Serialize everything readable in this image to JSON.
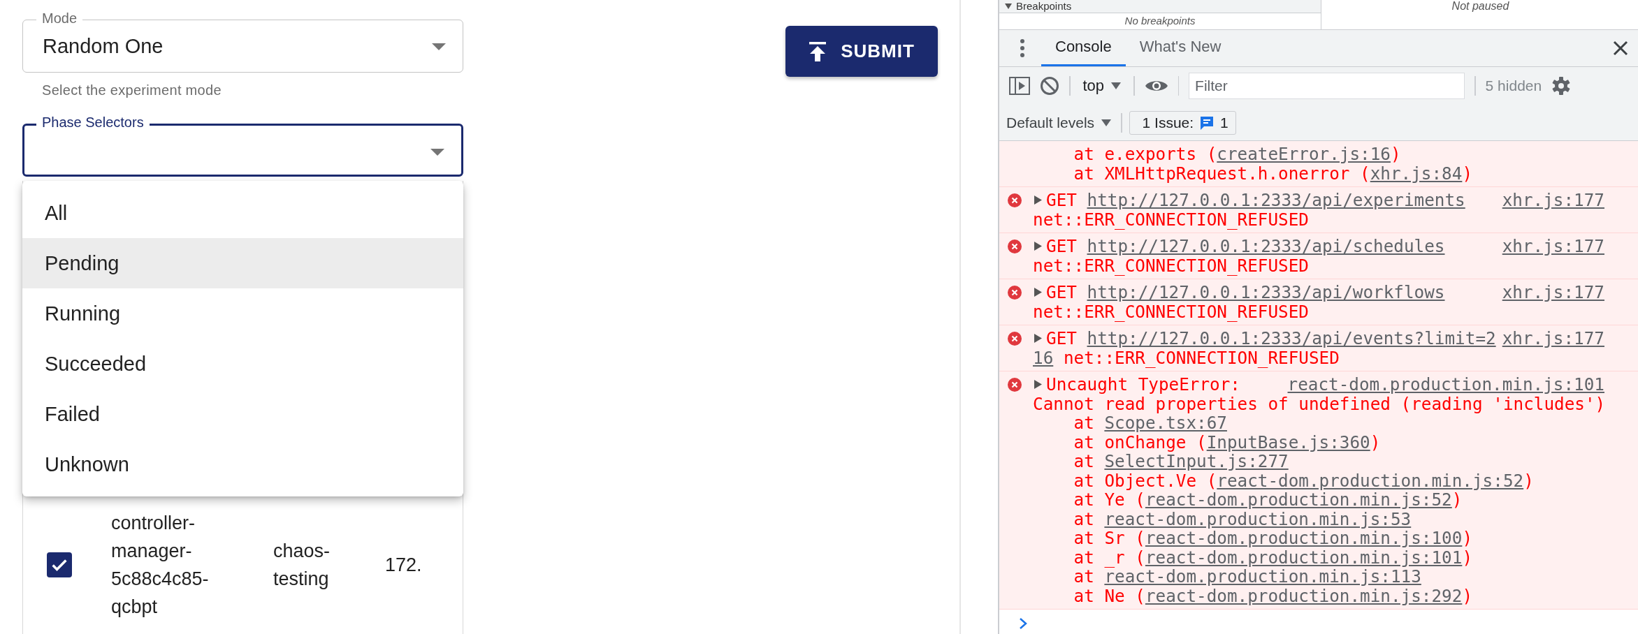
{
  "form": {
    "mode": {
      "label": "Mode",
      "value": "Random One",
      "helper": "Select the experiment mode"
    },
    "phase_selectors": {
      "label": "Phase Selectors",
      "focused": true
    },
    "submit_button": "SUBMIT"
  },
  "menu": {
    "items": [
      {
        "label": "All",
        "selected": false
      },
      {
        "label": "Pending",
        "selected": true
      },
      {
        "label": "Running",
        "selected": false
      },
      {
        "label": "Succeeded",
        "selected": false
      },
      {
        "label": "Failed",
        "selected": false
      },
      {
        "label": "Unknown",
        "selected": false
      }
    ]
  },
  "table": {
    "rows": [
      {
        "checked": true,
        "cells": [
          "controller-manager-5c88c4c85-qcbpt",
          "chaos-testing",
          "172."
        ]
      }
    ]
  },
  "devtools": {
    "sources": {
      "breakpoints_header": "Breakpoints",
      "breakpoints_empty": "No breakpoints",
      "status": "Not paused"
    },
    "tabs": [
      {
        "label": "Console",
        "selected": true
      },
      {
        "label": "What's New",
        "selected": false
      }
    ],
    "toolbar": {
      "context": "top",
      "filter_placeholder": "Filter",
      "hidden_count": "5 hidden",
      "levels": "Default levels",
      "issues_label": "1 Issue:",
      "issues_count": "1"
    },
    "messages": [
      {
        "kind": "trace",
        "lines": [
          {
            "indent": true,
            "parts": [
              {
                "text": "at e.exports ("
              },
              {
                "text": "createError.js:16",
                "link": true
              },
              {
                "text": ")"
              }
            ]
          },
          {
            "indent": true,
            "parts": [
              {
                "text": "at XMLHttpRequest.h.onerror ("
              },
              {
                "text": "xhr.js:84",
                "link": true
              },
              {
                "text": ")"
              }
            ]
          }
        ]
      },
      {
        "kind": "error",
        "source": "xhr.js:177",
        "lines": [
          {
            "indent": false,
            "parts": [
              {
                "text": "GET "
              },
              {
                "text": "http://127.0.0.1:2333/api/experiments",
                "link": true
              }
            ]
          },
          {
            "indent": false,
            "parts": [
              {
                "text": "net::ERR_CONNECTION_REFUSED"
              }
            ]
          }
        ]
      },
      {
        "kind": "error",
        "source": "xhr.js:177",
        "lines": [
          {
            "indent": false,
            "parts": [
              {
                "text": "GET "
              },
              {
                "text": "http://127.0.0.1:2333/api/schedules",
                "link": true
              }
            ]
          },
          {
            "indent": false,
            "parts": [
              {
                "text": "net::ERR_CONNECTION_REFUSED"
              }
            ]
          }
        ]
      },
      {
        "kind": "error",
        "source": "xhr.js:177",
        "lines": [
          {
            "indent": false,
            "parts": [
              {
                "text": "GET "
              },
              {
                "text": "http://127.0.0.1:2333/api/workflows",
                "link": true
              }
            ]
          },
          {
            "indent": false,
            "parts": [
              {
                "text": "net::ERR_CONNECTION_REFUSED"
              }
            ]
          }
        ]
      },
      {
        "kind": "error",
        "source": "xhr.js:177",
        "lines": [
          {
            "indent": false,
            "parts": [
              {
                "text": "GET "
              },
              {
                "text": "http://127.0.0.1:2333/api/events?limit=2",
                "link": true
              }
            ]
          },
          {
            "indent": false,
            "parts": [
              {
                "text": "16",
                "link": true
              },
              {
                "text": " net::ERR_CONNECTION_REFUSED"
              }
            ]
          }
        ]
      },
      {
        "kind": "error",
        "source": "react-dom.production.min.js:101",
        "lines": [
          {
            "indent": false,
            "parts": [
              {
                "text": "Uncaught TypeError:"
              }
            ]
          },
          {
            "indent": false,
            "parts": [
              {
                "text": "Cannot read properties of undefined (reading 'includes')"
              }
            ]
          },
          {
            "indent": true,
            "parts": [
              {
                "text": "at "
              },
              {
                "text": "Scope.tsx:67",
                "link": true
              }
            ]
          },
          {
            "indent": true,
            "parts": [
              {
                "text": "at onChange ("
              },
              {
                "text": "InputBase.js:360",
                "link": true
              },
              {
                "text": ")"
              }
            ]
          },
          {
            "indent": true,
            "parts": [
              {
                "text": "at "
              },
              {
                "text": "SelectInput.js:277",
                "link": true
              }
            ]
          },
          {
            "indent": true,
            "parts": [
              {
                "text": "at Object.Ve ("
              },
              {
                "text": "react-dom.production.min.js:52",
                "link": true
              },
              {
                "text": ")"
              }
            ]
          },
          {
            "indent": true,
            "parts": [
              {
                "text": "at Ye ("
              },
              {
                "text": "react-dom.production.min.js:52",
                "link": true
              },
              {
                "text": ")"
              }
            ]
          },
          {
            "indent": true,
            "parts": [
              {
                "text": "at "
              },
              {
                "text": "react-dom.production.min.js:53",
                "link": true
              }
            ]
          },
          {
            "indent": true,
            "parts": [
              {
                "text": "at Sr ("
              },
              {
                "text": "react-dom.production.min.js:100",
                "link": true
              },
              {
                "text": ")"
              }
            ]
          },
          {
            "indent": true,
            "parts": [
              {
                "text": "at _r ("
              },
              {
                "text": "react-dom.production.min.js:101",
                "link": true
              },
              {
                "text": ")"
              }
            ]
          },
          {
            "indent": true,
            "parts": [
              {
                "text": "at "
              },
              {
                "text": "react-dom.production.min.js:113",
                "link": true
              }
            ]
          },
          {
            "indent": true,
            "parts": [
              {
                "text": "at Ne ("
              },
              {
                "text": "react-dom.production.min.js:292",
                "link": true
              },
              {
                "text": ")"
              }
            ]
          }
        ]
      }
    ]
  }
}
